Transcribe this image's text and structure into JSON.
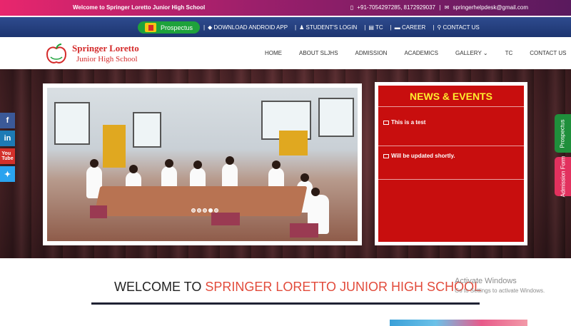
{
  "topbar": {
    "welcome": "Welcome to Springer Loretto Junior High School",
    "phone": "+91-7054297285, 8172929037",
    "email": "springerhelpdesk@gmail.com"
  },
  "linkbar": {
    "prospectus": "Prospectus",
    "links": [
      "DOWNLOAD ANDROID APP",
      "STUDENT'S LOGIN",
      "TC",
      "CAREER",
      "CONTACT US"
    ]
  },
  "logo": {
    "line1": "Springer Loretto",
    "line2": "Junior High School"
  },
  "menu": [
    "HOME",
    "ABOUT SLJHS",
    "ADMISSION",
    "ACADEMICS",
    "GALLERY",
    "TC",
    "CONTACT US"
  ],
  "news": {
    "title": "NEWS & EVENTS",
    "items": [
      "This is a test",
      "Will be updated shortly."
    ]
  },
  "social": [
    "facebook-icon",
    "linkedin-icon",
    "youtube-icon",
    "twitter-icon"
  ],
  "side_tabs": {
    "prospectus": "Prospectus",
    "admission": "Admission Form"
  },
  "welcome": {
    "prefix": "WELCOME TO ",
    "highlight": "SPRINGER LORETTO JUNIOR HIGH SCHOOL"
  },
  "activate": {
    "title": "Activate Windows",
    "subtitle": "Go to Settings to activate Windows."
  },
  "colors": {
    "accent_red": "#c80e0e",
    "nav_blue": "#1d3570",
    "news_title": "#ffee2e",
    "highlight": "#e24b3b"
  }
}
